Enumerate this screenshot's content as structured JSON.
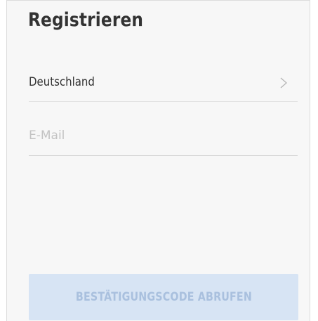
{
  "page": {
    "title": "Registrieren"
  },
  "form": {
    "country": {
      "label": "Deutschland",
      "icon": "chevron-right-icon"
    },
    "email": {
      "value": "",
      "placeholder": "E-Mail"
    },
    "submit_label": "BESTÄTIGUNGSCODE ABRUFEN"
  },
  "colors": {
    "background": "#f7f7f7",
    "text": "#333333",
    "placeholder": "#c3c3c3",
    "divider": "#e3e3e3",
    "button_background_disabled": "#d7e4f4",
    "button_text_disabled": "#a9c0de"
  }
}
